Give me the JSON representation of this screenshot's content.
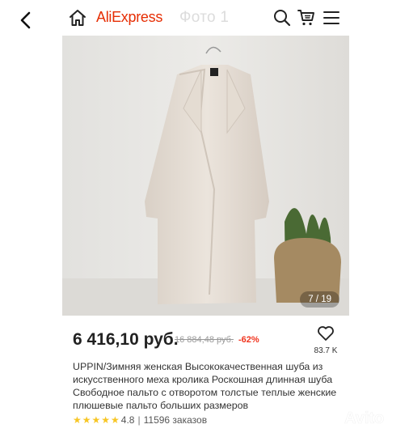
{
  "nav": {
    "back_icon": "chevron-left-icon"
  },
  "appbar": {
    "logo": "AliExpress",
    "photo_title": "Фото 1",
    "icons": [
      "home-icon",
      "search-icon",
      "cart-icon",
      "menu-icon"
    ]
  },
  "gallery": {
    "counter": "7 / 19"
  },
  "product": {
    "price": "6 416,10 руб.",
    "old_price": "16 884,48 руб.",
    "discount": "-62%",
    "wishlist_count": "83.7 K",
    "title": "UPPIN/Зимняя женская Высококачественная шуба из искусственного меха кролика Роскошная длинная шуба Свободное пальто с отворотом толстые теплые женские плюшевые пальто больших размеров",
    "stars": "★★★★★",
    "rating": "4.8",
    "orders": "11596 заказов"
  },
  "watermark": "Avito",
  "colors": {
    "brand": "#e62e04",
    "discount": "#f0341e",
    "star": "#f7c625"
  }
}
